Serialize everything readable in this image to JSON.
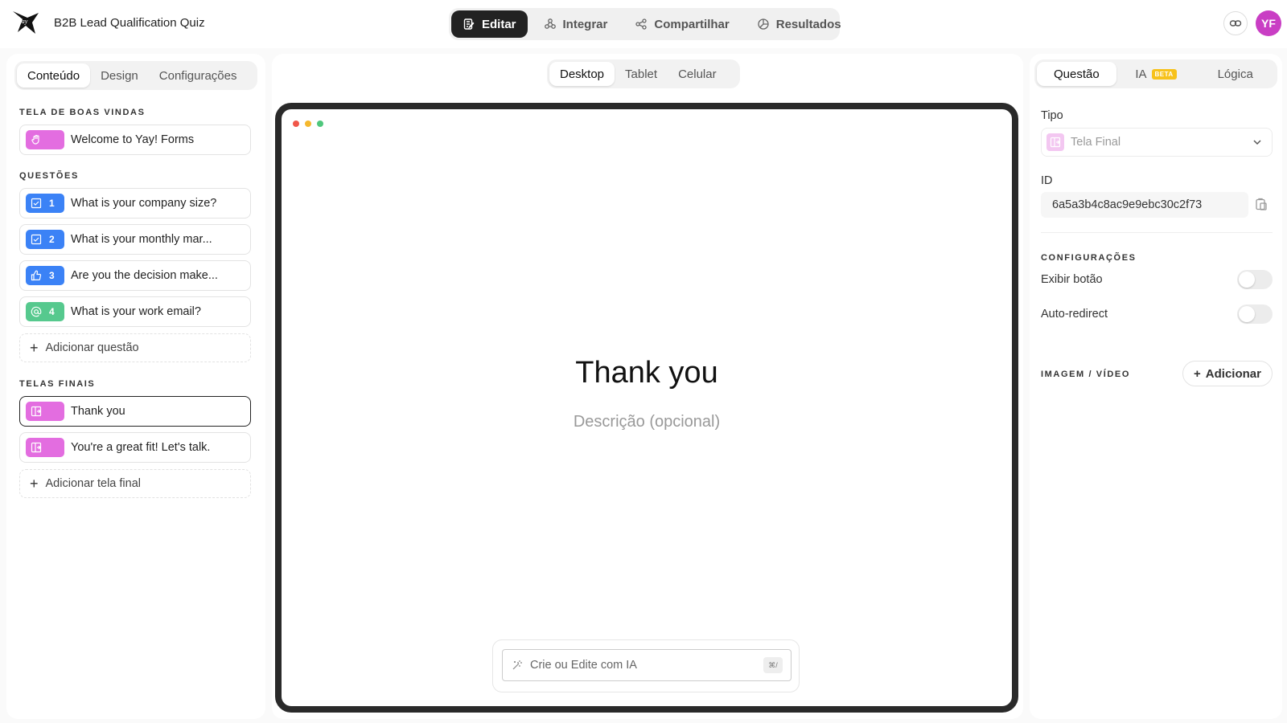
{
  "header": {
    "app_title": "B2B Lead Qualification Quiz",
    "mode_tabs": [
      {
        "label": "Editar",
        "icon": "edit-icon",
        "active": true
      },
      {
        "label": "Integrar",
        "icon": "integrate-icon",
        "active": false
      },
      {
        "label": "Compartilhar",
        "icon": "share-icon",
        "active": false
      },
      {
        "label": "Resultados",
        "icon": "results-icon",
        "active": false
      }
    ],
    "avatar_initials": "YF"
  },
  "left": {
    "tabs": [
      "Conteúdo",
      "Design",
      "Configurações"
    ],
    "welcome_title": "TELA DE BOAS VINDAS",
    "welcome_item": "Welcome to Yay! Forms",
    "questions_title": "QUESTÕES",
    "questions": [
      {
        "number": "1",
        "label": "What is your company size?",
        "icon": "checkbox-icon",
        "color": "#3b82f6"
      },
      {
        "number": "2",
        "label": "What is your monthly mar...",
        "icon": "checkbox-icon",
        "color": "#3b82f6"
      },
      {
        "number": "3",
        "label": "Are you the decision make...",
        "icon": "thumbs-up-icon",
        "color": "#3b82f6"
      },
      {
        "number": "4",
        "label": "What is your work email?",
        "icon": "at-sign-icon",
        "color": "#56c98e"
      }
    ],
    "add_question": "Adicionar questão",
    "endings_title": "TELAS FINAIS",
    "endings": [
      "Thank you",
      "You're a great fit! Let's talk."
    ],
    "add_ending": "Adicionar tela final"
  },
  "center": {
    "device_tabs": [
      "Desktop",
      "Tablet",
      "Celular"
    ],
    "preview_title": "Thank you",
    "preview_description": "Descrição (opcional)",
    "ai_placeholder": "Crie ou Edite com IA",
    "ai_shortcut": "⌘/"
  },
  "right": {
    "tabs": [
      "Questão",
      "IA",
      "Lógica"
    ],
    "beta_label": "BETA",
    "type_label": "Tipo",
    "type_value": "Tela Final",
    "id_label": "ID",
    "id_value": "6a5a3b4c8ac9e9ebc30c2f73",
    "settings_title": "CONFIGURAÇÕES",
    "show_button_label": "Exibir botão",
    "show_button_on": false,
    "auto_redirect_label": "Auto-redirect",
    "auto_redirect_on": false,
    "media_title": "IMAGEM / VÍDEO",
    "add_media_label": "Adicionar"
  },
  "colors": {
    "accent_dark": "#222222",
    "pink": "#e36de0",
    "blue": "#3b82f6",
    "green": "#56c98e",
    "beta": "#f7c21b",
    "avatar": "#c93ec4"
  }
}
